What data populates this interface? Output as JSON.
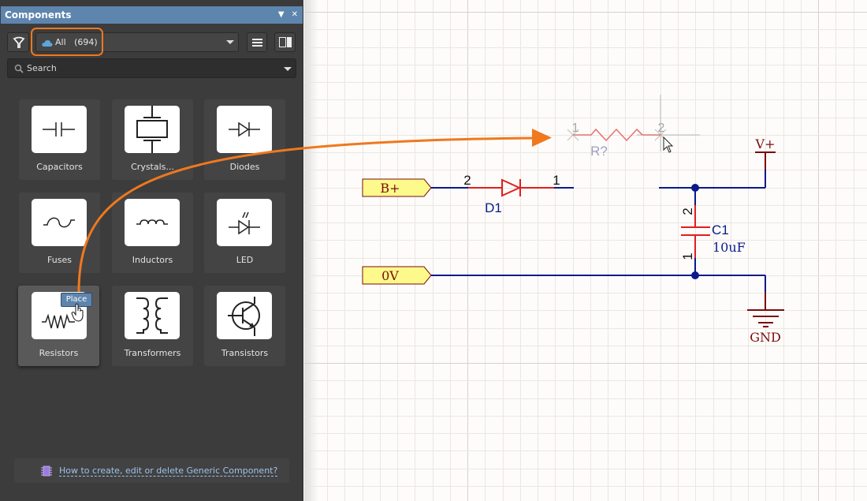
{
  "panel": {
    "title": "Components",
    "header_buttons": [
      {
        "icon": "dropdown-triangle-icon",
        "glyph": "▼"
      },
      {
        "icon": "close-icon",
        "glyph": "✕"
      }
    ],
    "library_selector": {
      "icon": "cloud-icon",
      "label": "All",
      "count": "(694)"
    },
    "search": {
      "placeholder": "Search"
    },
    "categories": [
      {
        "label": "Capacitors",
        "icon": "capacitor-symbol-icon"
      },
      {
        "label": "Crystals...",
        "icon": "crystal-symbol-icon"
      },
      {
        "label": "Diodes",
        "icon": "diode-symbol-icon"
      },
      {
        "label": "Fuses",
        "icon": "fuse-symbol-icon"
      },
      {
        "label": "Inductors",
        "icon": "inductor-symbol-icon"
      },
      {
        "label": "LED",
        "icon": "led-symbol-icon"
      },
      {
        "label": "Resistors",
        "icon": "resistor-symbol-icon",
        "active": true
      },
      {
        "label": "Transformers",
        "icon": "transformer-symbol-icon"
      },
      {
        "label": "Transistors",
        "icon": "transistor-symbol-icon"
      }
    ],
    "place_tooltip": "Place",
    "help_link": "How to create, edit or delete Generic Component?"
  },
  "schematic": {
    "ports": [
      {
        "name": "B+"
      },
      {
        "name": "0V"
      }
    ],
    "diode": {
      "designator": "D1",
      "pin_left": "2",
      "pin_right": "1"
    },
    "capacitor": {
      "designator": "C1",
      "value": "10uF",
      "pin_top": "2",
      "pin_bottom": "1"
    },
    "resistor_ghost": {
      "designator": "R?",
      "pin_left": "1",
      "pin_right": "2"
    },
    "power": {
      "vplus": "V+",
      "gnd": "GND"
    },
    "colors": {
      "wire": "#0a1a8c",
      "component": "#e01e1e",
      "power": "#7a0c0c",
      "port_fill": "#fdf98a",
      "port_border": "#7a0c0c",
      "designator": "#0a1a8c",
      "drag_arrow": "#f0781e"
    }
  }
}
